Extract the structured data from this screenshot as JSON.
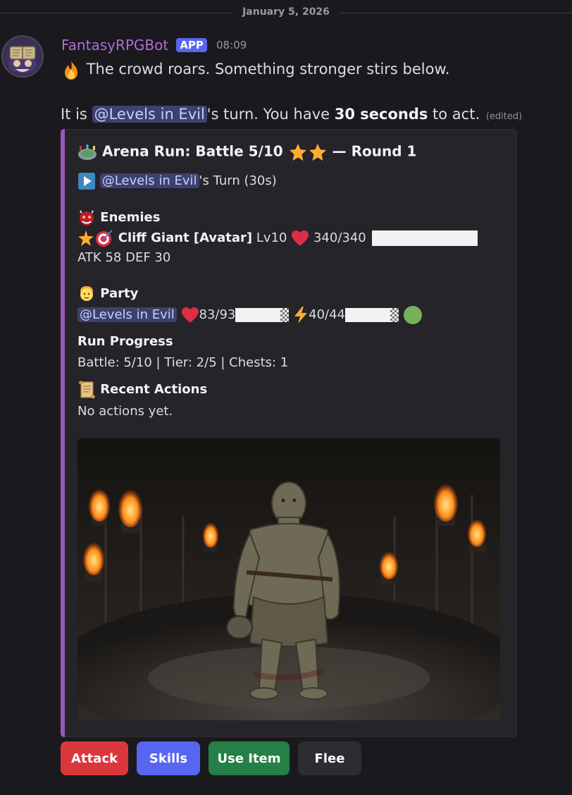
{
  "date_divider": "January 5, 2026",
  "message": {
    "username": "FantasyRPGBot",
    "badge": "APP",
    "time": "08:09",
    "line1": "The crowd roars. Something stronger stirs below.",
    "line2_prefix": "It is ",
    "mention": "@Levels in Evil",
    "line2_mid": "'s turn. You have ",
    "line2_bold": "30 seconds",
    "line2_suffix": " to act.",
    "edited": "(edited)"
  },
  "embed": {
    "title": "Arena Run: Battle 5/10",
    "title_suffix": "— Round 1",
    "turn_mention": "@Levels in Evil",
    "turn_suffix": "'s Turn (30s)",
    "enemies_heading": "Enemies",
    "enemy_name": "Cliff Giant [Avatar]",
    "enemy_level": "Lv10",
    "enemy_hp": "340/340",
    "enemy_stats_a": "ATK",
    "enemy_stats_b": "58 DEF 30",
    "party_heading": "Party",
    "party_mention": "@Levels in Evil",
    "party_hp": "83/93",
    "party_energy": "40/44",
    "progress_heading": "Run Progress",
    "progress_text": "Battle: 5/10 | Tier: 2/5 | Chests: 1",
    "recent_heading": "Recent Actions",
    "recent_text": "No actions yet."
  },
  "buttons": {
    "attack": "Attack",
    "skills": "Skills",
    "use_item": "Use Item",
    "flee": "Flee"
  },
  "colors": {
    "embed_bar": "#9b59b6",
    "attack": "#da373c",
    "skills": "#5865f2",
    "use_item": "#248046",
    "flee": "#2b2d31"
  }
}
